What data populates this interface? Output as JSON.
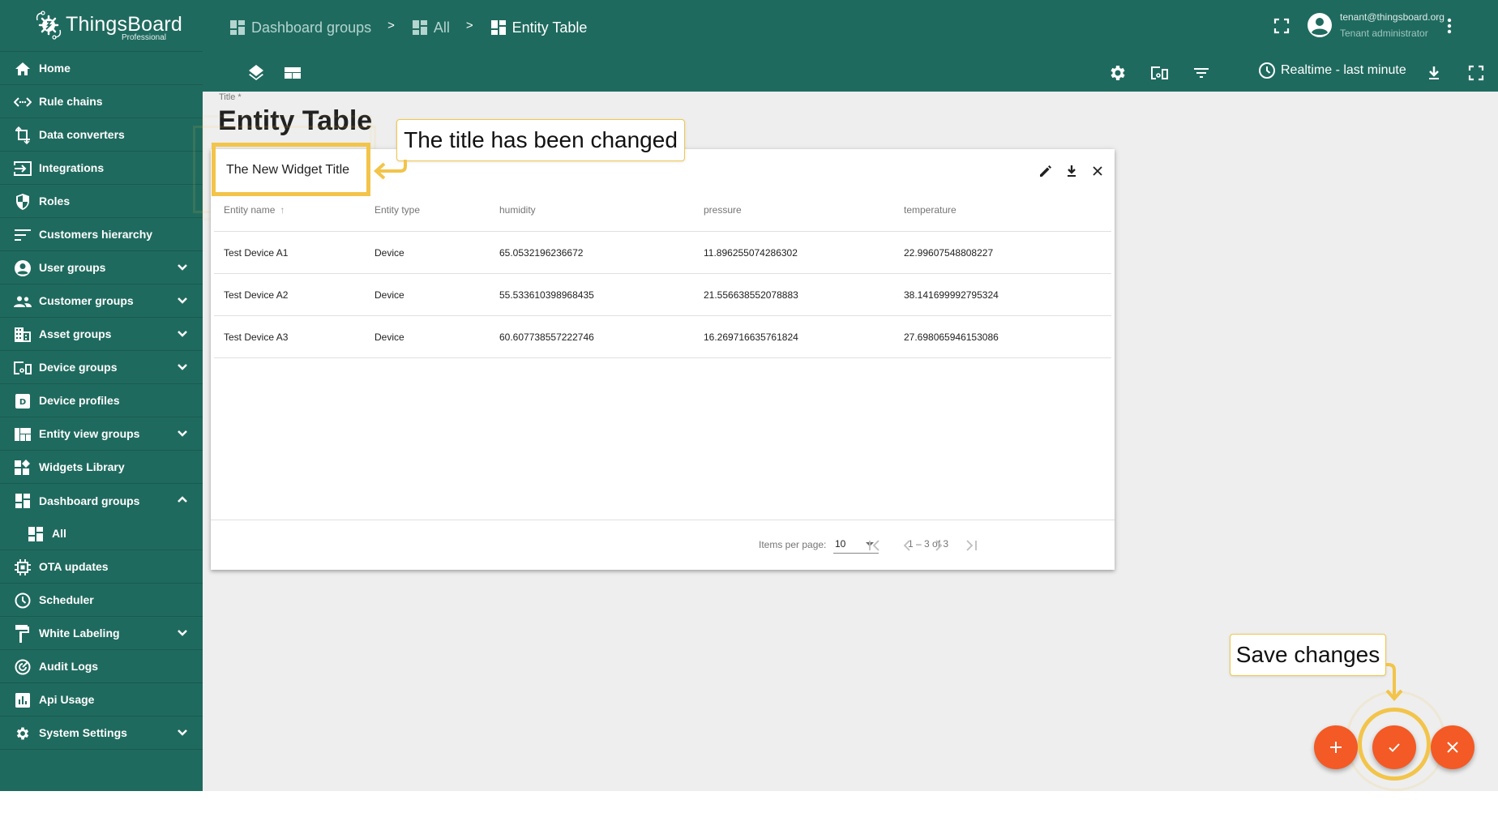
{
  "brand": {
    "name": "ThingsBoard",
    "edition": "Professional"
  },
  "sidebar": {
    "items": [
      {
        "label": "Home",
        "icon": "home-icon",
        "expandable": false
      },
      {
        "label": "Rule chains",
        "icon": "rule-chains-icon",
        "expandable": false
      },
      {
        "label": "Data converters",
        "icon": "crop-icon",
        "expandable": false
      },
      {
        "label": "Integrations",
        "icon": "input-icon",
        "expandable": false
      },
      {
        "label": "Roles",
        "icon": "shield-icon",
        "expandable": false
      },
      {
        "label": "Customers hierarchy",
        "icon": "sort-icon",
        "expandable": false
      },
      {
        "label": "User groups",
        "icon": "account-circle-icon",
        "expandable": true,
        "expanded": false
      },
      {
        "label": "Customer groups",
        "icon": "people-icon",
        "expandable": true,
        "expanded": false
      },
      {
        "label": "Asset groups",
        "icon": "domain-icon",
        "expandable": true,
        "expanded": false
      },
      {
        "label": "Device groups",
        "icon": "devices-icon",
        "expandable": true,
        "expanded": false
      },
      {
        "label": "Device profiles",
        "icon": "device-profile-icon",
        "expandable": false
      },
      {
        "label": "Entity view groups",
        "icon": "view-quilt-icon",
        "expandable": true,
        "expanded": false
      },
      {
        "label": "Widgets Library",
        "icon": "widgets-icon",
        "expandable": false
      },
      {
        "label": "Dashboard groups",
        "icon": "dashboard-icon",
        "expandable": true,
        "expanded": true
      },
      {
        "label": "All",
        "icon": "dashboard-icon",
        "sub": true
      },
      {
        "label": "OTA updates",
        "icon": "memory-icon",
        "expandable": false
      },
      {
        "label": "Scheduler",
        "icon": "schedule-icon",
        "expandable": false
      },
      {
        "label": "White Labeling",
        "icon": "format-paint-icon",
        "expandable": true,
        "expanded": false
      },
      {
        "label": "Audit Logs",
        "icon": "track-changes-icon",
        "expandable": false
      },
      {
        "label": "Api Usage",
        "icon": "insert-chart-icon",
        "expandable": false
      },
      {
        "label": "System Settings",
        "icon": "settings-icon",
        "expandable": true,
        "expanded": false
      }
    ]
  },
  "header": {
    "breadcrumbs": [
      "Dashboard groups",
      "All",
      "Entity Table"
    ],
    "breadcrumb_separator": ">",
    "user": {
      "email": "tenant@thingsboard.org",
      "role": "Tenant administrator"
    },
    "timewindow_label": "Realtime - last minute"
  },
  "dashboard": {
    "title_field_label": "Title *",
    "title": "Entity Table"
  },
  "widget": {
    "title": "The New Widget Title",
    "columns": [
      "Entity name",
      "Entity type",
      "humidity",
      "pressure",
      "temperature"
    ],
    "sort_column": "Entity name",
    "sort_direction": "asc",
    "rows": [
      [
        "Test Device A1",
        "Device",
        "65.0532196236672",
        "11.896255074286302",
        "22.99607548808227"
      ],
      [
        "Test Device A2",
        "Device",
        "55.533610398968435",
        "21.556638552078883",
        "38.141699992795324"
      ],
      [
        "Test Device A3",
        "Device",
        "60.607738557222746",
        "16.269716635761824",
        "27.698065946153086"
      ]
    ],
    "paginator": {
      "items_per_page_label": "Items per page:",
      "items_per_page": "10",
      "range_label": "1 – 3 of 3"
    }
  },
  "annotations": {
    "title_changed": "The title has been changed",
    "save_changes": "Save changes",
    "highlight_color": "#f2c44a"
  },
  "colors": {
    "primary": "#1f6a5e",
    "fab": "#f35a25",
    "background": "#eeeeee"
  }
}
